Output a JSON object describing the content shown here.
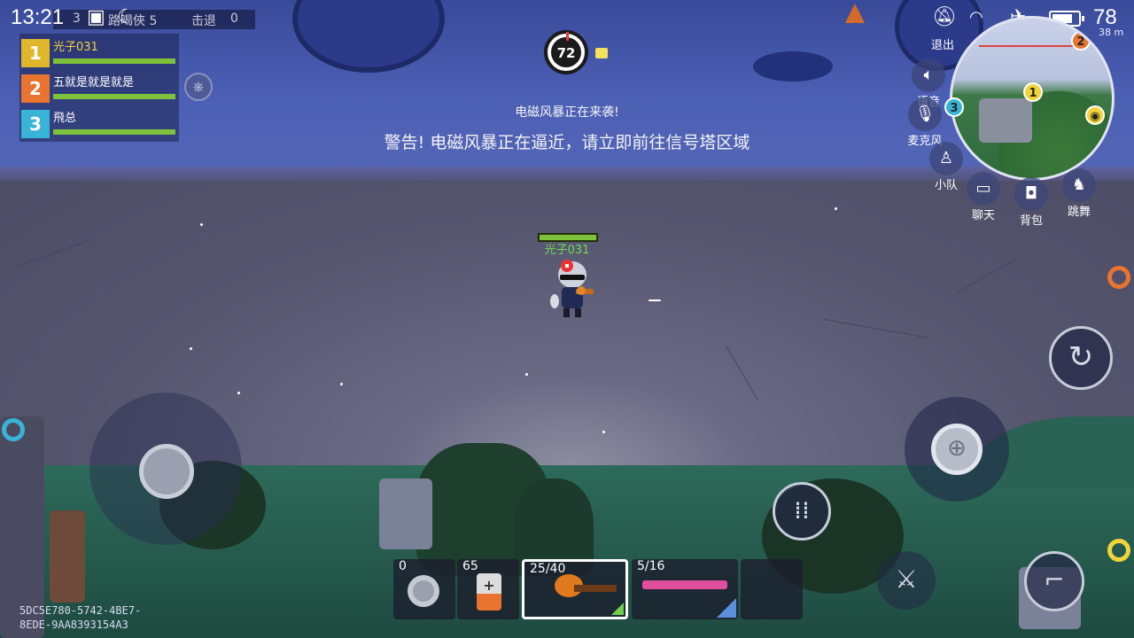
{
  "status_bar": {
    "time": "13:21",
    "battery_level": "78",
    "battery_percent": 78
  },
  "kill_strip": {
    "left_text": "3",
    "mid_text": "路喝俠 5",
    "kills_label": "击退",
    "kills_value": "0"
  },
  "team": [
    {
      "num": "1",
      "name": "光子031",
      "color": "#e0b62c",
      "hp_percent": 100
    },
    {
      "num": "2",
      "name": "五就是就是就是",
      "color": "#e8742f",
      "hp_percent": 100
    },
    {
      "num": "3",
      "name": "飛总",
      "color": "#38b4d6",
      "hp_percent": 100
    }
  ],
  "hud": {
    "compass_value": "72",
    "notice_small": "电磁风暴正在来袭!",
    "notice_big": "警告! 电磁风暴正在逼近，请立即前往信号塔区域"
  },
  "player": {
    "name": "光子031",
    "hp_percent": 100
  },
  "minimap": {
    "distance": "38 m",
    "markers": [
      {
        "label": "1",
        "color": "#f2d33a"
      },
      {
        "label": "2",
        "color": "#e8742f"
      },
      {
        "label": "3",
        "color": "#38b4d6"
      }
    ]
  },
  "side_buttons": {
    "exit": "退出",
    "voice": "语音",
    "mic": "麦克风",
    "squad": "小队",
    "chat": "聊天",
    "backpack": "背包",
    "dance": "跳舞"
  },
  "inventory": [
    {
      "count": "0",
      "item": "duct-tape"
    },
    {
      "count": "65",
      "item": "medkit"
    },
    {
      "count": "25/40",
      "item": "pumpkin-gun",
      "selected": true
    },
    {
      "count": "5/16",
      "item": "pink-shotgun"
    },
    {
      "count": "",
      "item": "empty"
    }
  ],
  "device_id": {
    "line1": "5DC5E780-5742-4BE7-",
    "line2": "8EDE-9AA8393154A3"
  },
  "icons": {
    "steer": "steering-wheel-icon",
    "reload": "reload-icon",
    "fire": "crosshair-icon",
    "ammo": "ammo-swap-icon",
    "melee": "sword-icon",
    "weapon_switch": "pistol-icon"
  }
}
